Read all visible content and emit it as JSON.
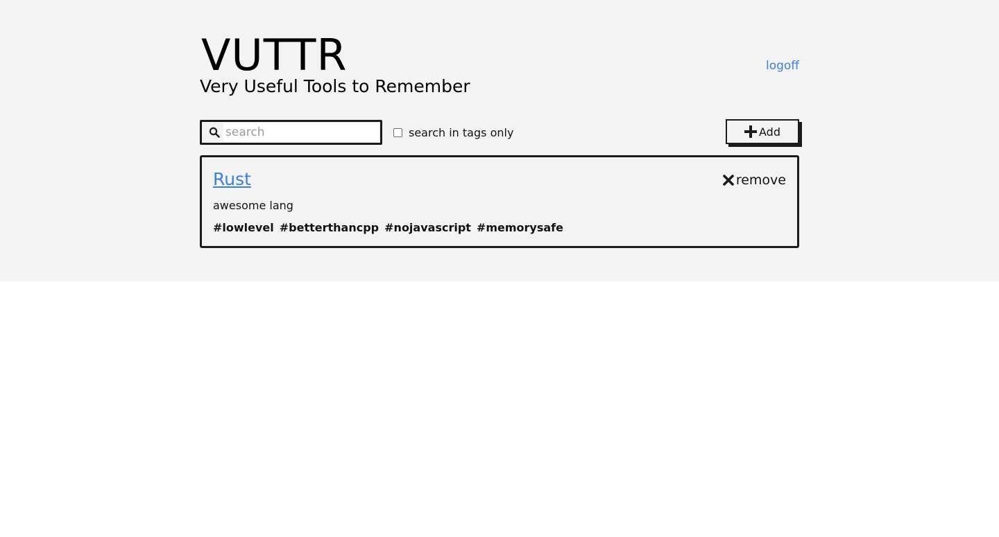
{
  "header": {
    "title": "VUTTR",
    "subtitle": "Very Useful Tools to Remember",
    "logoff_label": "logoff"
  },
  "toolbar": {
    "search_placeholder": "search",
    "search_value": "",
    "tags_only_label": "search in tags only",
    "tags_only_checked": false,
    "add_label": "Add"
  },
  "tools": [
    {
      "name": "Rust",
      "description": "awesome lang",
      "remove_label": "remove",
      "tags": [
        "#lowlevel",
        "#betterthancpp",
        "#nojavascript",
        "#memorysafe"
      ]
    }
  ],
  "colors": {
    "accent": "#3b7ee8",
    "background": "#f3f3f3",
    "border": "#1b1b1b"
  },
  "icons": {
    "search": "search-icon",
    "add": "plus-icon",
    "remove": "close-icon"
  }
}
